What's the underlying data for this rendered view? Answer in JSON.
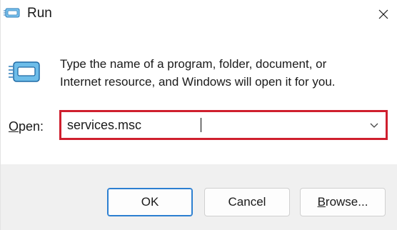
{
  "window": {
    "title": "Run",
    "icon": "run-icon",
    "close_icon": "close-icon"
  },
  "description": {
    "line1": "Type the name of a program, folder, document, or",
    "line2": "Internet resource, and Windows will open it for you."
  },
  "open_field": {
    "label_accel": "O",
    "label_rest": "pen:",
    "value": "services.msc",
    "dropdown_icon": "chevron-down-icon",
    "highlight_color": "#cf1f2e"
  },
  "buttons": {
    "ok": "OK",
    "cancel": "Cancel",
    "browse_accel": "B",
    "browse_rest": "rowse..."
  },
  "colors": {
    "accent": "#2c7fd1",
    "footer_bg": "#f0f0f0"
  }
}
